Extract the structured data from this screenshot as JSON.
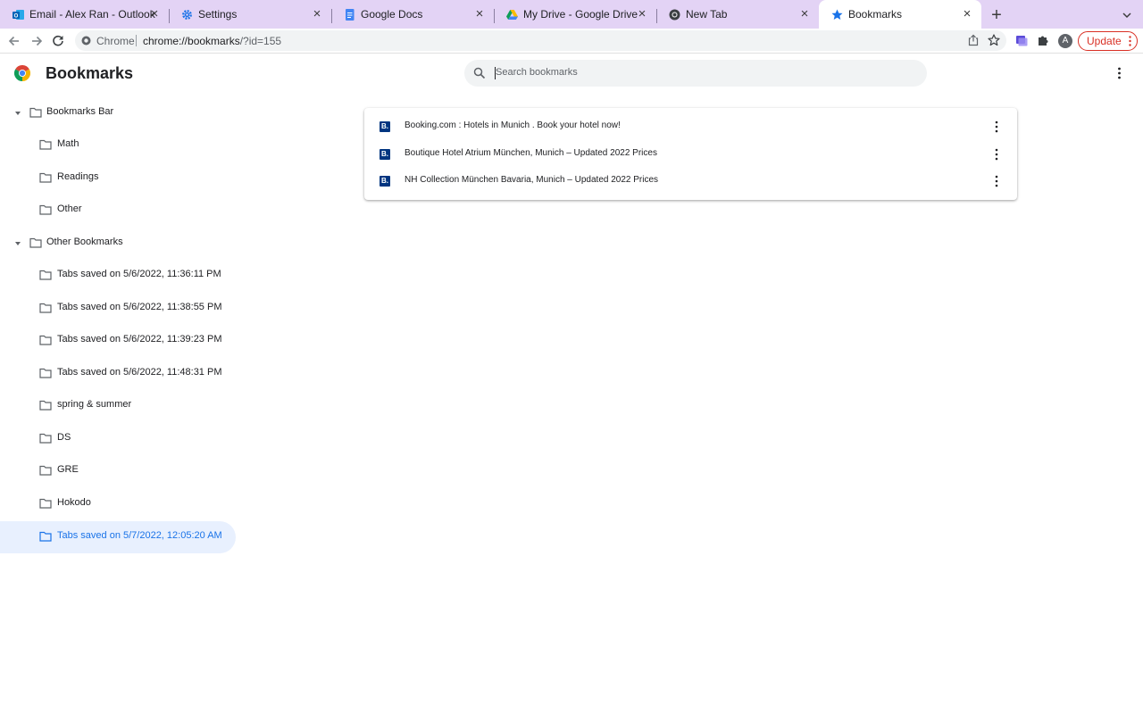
{
  "tabs": [
    {
      "title": "Email - Alex Ran - Outlook",
      "icon": "outlook-icon"
    },
    {
      "title": "Settings",
      "icon": "settings-gear-icon"
    },
    {
      "title": "Google Docs",
      "icon": "google-docs-icon"
    },
    {
      "title": "My Drive - Google Drive",
      "icon": "google-drive-icon"
    },
    {
      "title": "New Tab",
      "icon": "chrome-icon"
    },
    {
      "title": "Bookmarks",
      "icon": "star-icon",
      "active": true
    }
  ],
  "omnibox": {
    "scheme_label": "Chrome",
    "url_host": "chrome://bookmarks",
    "url_path": "/?id=155"
  },
  "toolbar": {
    "avatar_initial": "A",
    "update_label": "Update"
  },
  "header": {
    "title": "Bookmarks",
    "search_placeholder": "Search bookmarks"
  },
  "sidebar": {
    "items": [
      {
        "label": "Bookmarks Bar",
        "expanded": true,
        "level": 0
      },
      {
        "label": "Math",
        "level": 1
      },
      {
        "label": "Readings",
        "level": 1
      },
      {
        "label": "Other",
        "level": 1
      },
      {
        "label": "Other Bookmarks",
        "expanded": true,
        "level": 0
      },
      {
        "label": "Tabs saved on 5/6/2022, 11:36:11 PM",
        "level": 1
      },
      {
        "label": "Tabs saved on 5/6/2022, 11:38:55 PM",
        "level": 1
      },
      {
        "label": "Tabs saved on 5/6/2022, 11:39:23 PM",
        "level": 1
      },
      {
        "label": "Tabs saved on 5/6/2022, 11:48:31 PM",
        "level": 1
      },
      {
        "label": "spring & summer",
        "level": 1
      },
      {
        "label": "DS",
        "level": 1
      },
      {
        "label": "GRE",
        "level": 1
      },
      {
        "label": "Hokodo",
        "level": 1
      },
      {
        "label": "Tabs saved on 5/7/2022, 12:05:20 AM",
        "level": 1,
        "selected": true
      }
    ]
  },
  "bookmarks": [
    {
      "title": "Booking.com : Hotels in Munich . Book your hotel now!",
      "favicon_text": "B."
    },
    {
      "title": "Boutique Hotel Atrium München, Munich – Updated 2022 Prices",
      "favicon_text": "B."
    },
    {
      "title": "NH Collection München Bavaria, Munich – Updated 2022 Prices",
      "favicon_text": "B."
    }
  ],
  "colors": {
    "tabstrip_bg": "#e3d3f5",
    "accent_blue": "#1a73e8",
    "selected_bg": "#e8f0fe",
    "update_red": "#d93025",
    "booking_blue": "#003580"
  }
}
